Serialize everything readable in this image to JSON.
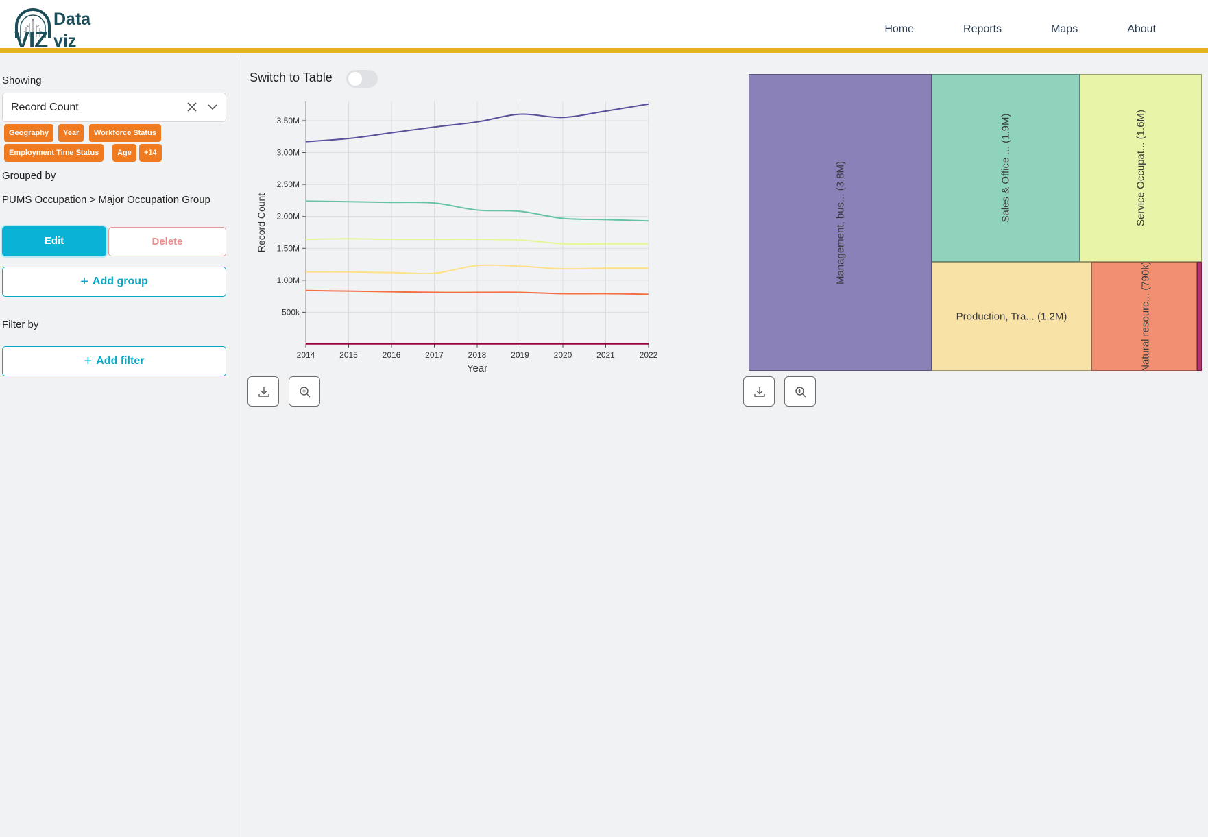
{
  "header": {
    "logo": {
      "word1": "Data",
      "word2": "viz",
      "mark": "VIZ"
    },
    "nav": [
      "Home",
      "Reports",
      "Maps",
      "About"
    ]
  },
  "sidebar": {
    "showing_label": "Showing",
    "measure_select": {
      "value": "Record Count"
    },
    "chips": [
      "Geography",
      "Year",
      "Workforce Status",
      "Employment Time Status",
      "Age",
      "+14"
    ],
    "grouped_by_label": "Grouped by",
    "grouped_by_value": "PUMS Occupation > Major Occupation Group",
    "edit_label": "Edit",
    "delete_label": "Delete",
    "add_group_label": "Add group",
    "filter_by_label": "Filter by",
    "add_filter_label": "Add filter"
  },
  "main": {
    "switch_label": "Switch to Table",
    "switch_on": false
  },
  "chart_data": [
    {
      "type": "line",
      "xlabel": "Year",
      "ylabel": "Record Count",
      "x": [
        2014,
        2015,
        2016,
        2017,
        2018,
        2019,
        2020,
        2021,
        2022
      ],
      "xlim": [
        2014,
        2022
      ],
      "ylim": [
        0,
        3800000
      ],
      "yticks": [
        500000,
        1000000,
        1500000,
        2000000,
        2500000,
        3000000,
        3500000
      ],
      "ytick_labels": [
        "500k",
        "1.00M",
        "1.50M",
        "2.00M",
        "2.50M",
        "3.00M",
        "3.50M"
      ],
      "grid": true,
      "series": [
        {
          "color": "#5b4f9b",
          "values": [
            3170000,
            3220000,
            3310000,
            3400000,
            3480000,
            3600000,
            3550000,
            3650000,
            3760000
          ]
        },
        {
          "color": "#66c2a5",
          "values": [
            2240000,
            2230000,
            2220000,
            2210000,
            2100000,
            2080000,
            1970000,
            1950000,
            1930000
          ]
        },
        {
          "color": "#e6f598",
          "values": [
            1640000,
            1650000,
            1640000,
            1640000,
            1640000,
            1630000,
            1570000,
            1570000,
            1570000
          ]
        },
        {
          "color": "#fee08b",
          "values": [
            1130000,
            1130000,
            1120000,
            1110000,
            1230000,
            1220000,
            1180000,
            1190000,
            1190000
          ]
        },
        {
          "color": "#f46d43",
          "values": [
            840000,
            830000,
            820000,
            810000,
            810000,
            810000,
            790000,
            790000,
            780000
          ]
        },
        {
          "color": "#9e0142",
          "values": [
            5000,
            5000,
            5000,
            5000,
            5000,
            5000,
            5000,
            5000,
            5000
          ]
        }
      ]
    },
    {
      "type": "treemap",
      "cells": [
        {
          "label": "Management, bus... (3.8M)",
          "value": 3800000,
          "color": "#8981b8"
        },
        {
          "label": "Sales & Office ... (1.9M)",
          "value": 1900000,
          "color": "#8fd3bd"
        },
        {
          "label": "Service Occupat... (1.6M)",
          "value": 1600000,
          "color": "#e8f4a8"
        },
        {
          "label": "Production, Tra... (1.2M)",
          "value": 1200000,
          "color": "#f9e2a6"
        },
        {
          "label": "Natural resourc... (790k)",
          "value": 790000,
          "color": "#f28f70"
        },
        {
          "label": "",
          "value": 10000,
          "color": "#b5336b"
        }
      ]
    }
  ]
}
